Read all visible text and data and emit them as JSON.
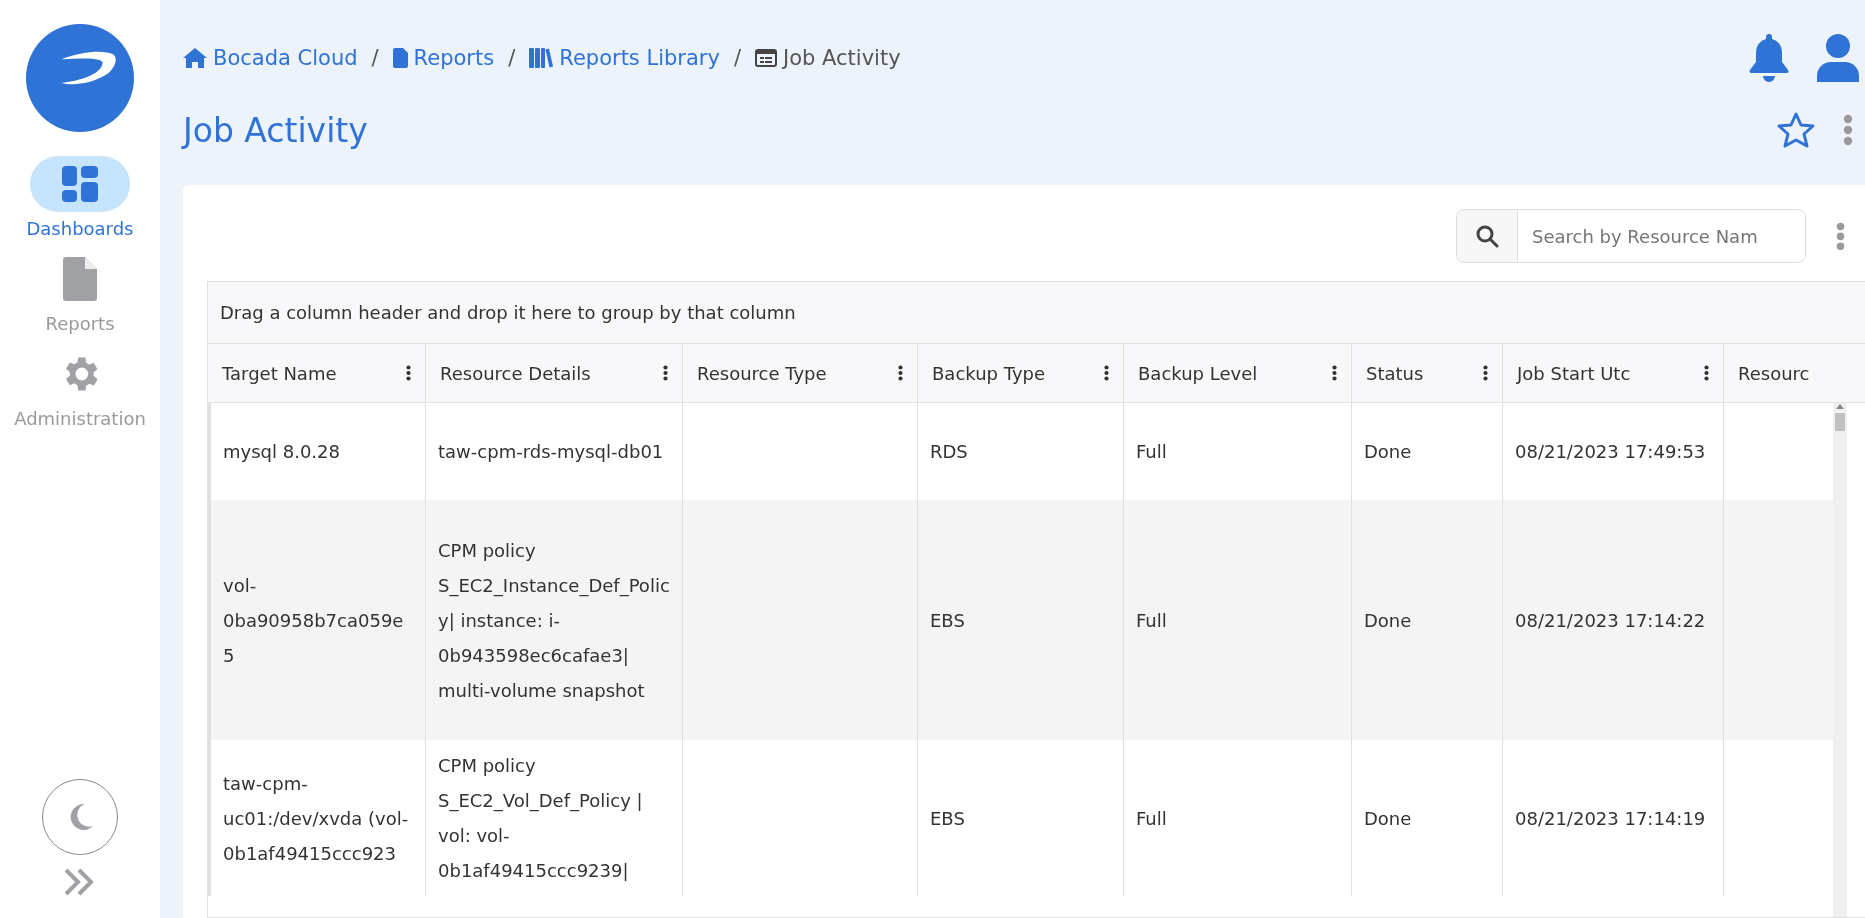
{
  "sidebar": {
    "items": [
      {
        "label": "Dashboards",
        "kind": "dashboards",
        "selected": true
      },
      {
        "label": "Reports",
        "kind": "reports",
        "selected": false
      },
      {
        "label": "Administration",
        "kind": "admin",
        "selected": false
      }
    ]
  },
  "breadcrumbs": [
    {
      "label": "Bocada Cloud",
      "kind": "home"
    },
    {
      "label": "Reports",
      "kind": "file",
      "separator": "/"
    },
    {
      "label": "Reports Library",
      "kind": "library",
      "separator": "/"
    },
    {
      "label": "Job Activity",
      "kind": "current",
      "separator": "/"
    }
  ],
  "page_title": "Job Activity",
  "search": {
    "placeholder": "Search by Resource Nam"
  },
  "table": {
    "group_hint": "Drag a column header and drop it here to group by that column",
    "columns": [
      "Target Name",
      "Resource Details",
      "Resource Type",
      "Backup Type",
      "Backup Level",
      "Status",
      "Job Start Utc",
      "Resourc"
    ],
    "rows": [
      [
        "mysql 8.0.28",
        "taw-cpm-rds-mysql-db01",
        "",
        "RDS",
        "Full",
        "Done",
        "08/21/2023 17:49:53",
        ""
      ],
      [
        "vol-0ba90958b7ca059e5",
        "CPM policy S_EC2_Instance_Def_Policy| instance: i-0b943598ec6cafae3| multi-volume snapshot",
        "",
        "EBS",
        "Full",
        "Done",
        "08/21/2023 17:14:22",
        ""
      ],
      [
        "taw-cpm-uc01:/dev/xvda (vol-0b1af49415ccc923",
        "CPM policy S_EC2_Vol_Def_Policy | vol: vol-0b1af49415ccc9239|",
        "",
        "EBS",
        "Full",
        "Done",
        "08/21/2023 17:14:19",
        ""
      ]
    ]
  }
}
